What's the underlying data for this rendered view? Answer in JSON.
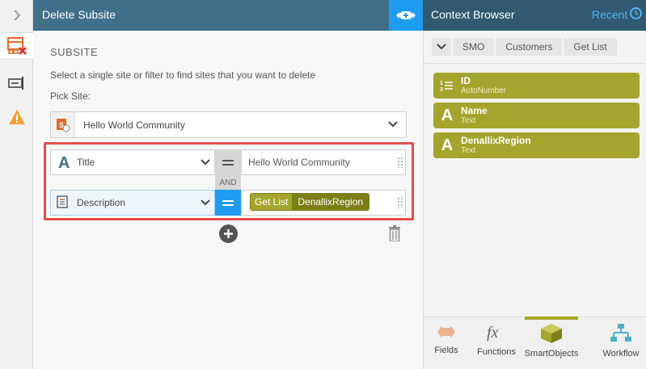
{
  "header": {
    "title": "Delete Subsite"
  },
  "context_browser": {
    "title": "Context Browser",
    "recent_label": "Recent",
    "breadcrumb": [
      "SMO",
      "Customers",
      "Get List"
    ],
    "items": [
      {
        "name": "ID",
        "type": "AutoNumber",
        "icon": "autonumber-icon"
      },
      {
        "name": "Name",
        "type": "Text",
        "icon": "text-icon"
      },
      {
        "name": "DenallixRegion",
        "type": "Text",
        "icon": "text-icon"
      }
    ],
    "tabs": [
      {
        "label": "Fields",
        "icon": "fields-icon"
      },
      {
        "label": "Functions",
        "icon": "functions-icon"
      },
      {
        "label": "SmartObjects",
        "icon": "smartobjects-icon",
        "active": true
      },
      {
        "label": "Workflow",
        "icon": "workflow-icon"
      }
    ]
  },
  "subsite": {
    "section_label": "SUBSITE",
    "instruction": "Select a single site or filter to find sites that you want to delete",
    "pick_label": "Pick Site:",
    "pick_value": "Hello World Community"
  },
  "filter": {
    "rows": [
      {
        "field": "Title",
        "field_icon": "text-icon",
        "operator": "=",
        "value": "Hello World Community"
      },
      {
        "field": "Description",
        "field_icon": "memo-icon",
        "operator": "=",
        "token_source": "Get List",
        "token_field": "DenallixRegion"
      }
    ],
    "join": "AND",
    "fx_glyph": "fx"
  },
  "colors": {
    "header": "#3f6f89",
    "accent": "#1e9cf0",
    "token": "#a4a52d",
    "highlight": "#e34d4d"
  }
}
